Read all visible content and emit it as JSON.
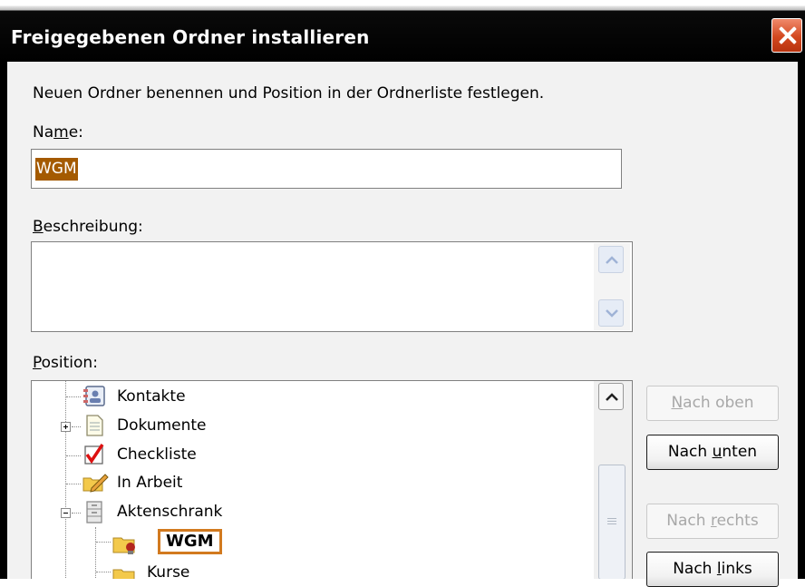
{
  "window": {
    "title": "Freigegebenen Ordner installieren"
  },
  "dialog": {
    "intro": "Neuen Ordner benennen und Position in der Ordnerliste festlegen.",
    "name_label_pre": "Na",
    "name_label_key": "m",
    "name_label_post": "e:",
    "name_value": "WGM",
    "description_label_key": "B",
    "description_label_post": "eschreibung:",
    "description_value": "",
    "position_label_key": "P",
    "position_label_post": "osition:"
  },
  "tree": {
    "items": [
      {
        "label": "Kontakte",
        "icon": "contacts-icon"
      },
      {
        "label": "Dokumente",
        "icon": "document-icon",
        "expander": "plus"
      },
      {
        "label": "Checkliste",
        "icon": "checkmark-icon"
      },
      {
        "label": "In Arbeit",
        "icon": "folder-pencil-icon"
      },
      {
        "label": "Aktenschrank",
        "icon": "cabinet-icon",
        "expander": "minus"
      },
      {
        "label": "WGM",
        "icon": "shared-folder-icon",
        "editing": true
      },
      {
        "label": "Kurse",
        "icon": "folder-icon"
      }
    ]
  },
  "buttons": {
    "up_pre": "",
    "up_key": "N",
    "up_post": "ach oben",
    "down_pre": "Nach ",
    "down_key": "u",
    "down_post": "nten",
    "right_pre": "Nach ",
    "right_key": "r",
    "right_post": "echts",
    "left_pre": "Nach ",
    "left_key": "l",
    "left_post": "inks"
  },
  "colors": {
    "selection": "#a45a00",
    "edit_border": "#d27a1f",
    "close_button": "#d3481f"
  }
}
